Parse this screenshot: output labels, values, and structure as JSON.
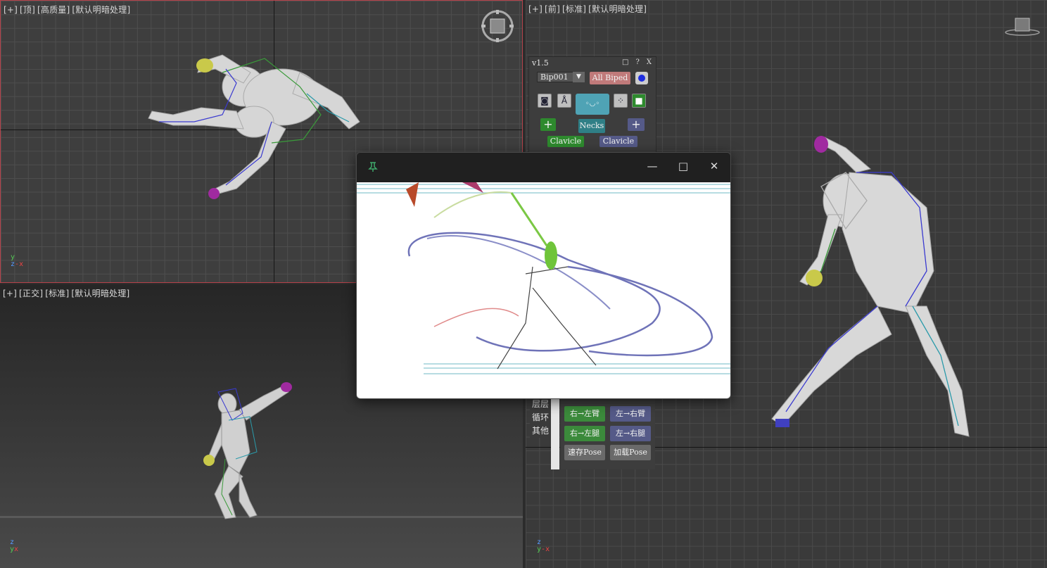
{
  "viewports": {
    "top": {
      "label": [
        "[+]",
        "[顶]",
        "[高质量]",
        "[默认明暗处理]"
      ],
      "axes": {
        "y": "y",
        "z": "z",
        "x": "x"
      }
    },
    "left": {
      "label": [
        "[+]",
        "[正交]",
        "[标准]",
        "[默认明暗处理]"
      ],
      "axes": {
        "y": "y",
        "z": "z",
        "x": "x"
      }
    },
    "front": {
      "label": [
        "[+]",
        "[前]",
        "[标准]",
        "[默认明暗处理]"
      ],
      "axes": {
        "y": "y",
        "z": "z",
        "x": "x"
      }
    }
  },
  "biped_panel": {
    "version": "v1.5",
    "title_buttons": [
      "□",
      "?",
      "X"
    ],
    "bip_select": "Bip001",
    "all_biped": "All Biped",
    "necks": "Necks",
    "clavicle_left": "Clavicle",
    "clavicle_right": "Clavicle",
    "plus": "+"
  },
  "lower_panel": {
    "side_tabs": [
      "层层",
      "循环",
      "其他"
    ],
    "buttons": [
      {
        "label": "右→左臂",
        "color": "#3b8a3b"
      },
      {
        "label": "左→右臂",
        "color": "#555a88"
      },
      {
        "label": "右→左腿",
        "color": "#3b8a3b"
      },
      {
        "label": "左→右腿",
        "color": "#555a88"
      },
      {
        "label": "速存Pose",
        "color": "#6a6a6a"
      },
      {
        "label": "加载Pose",
        "color": "#6a6a6a"
      }
    ]
  },
  "floating_window": {
    "pin_icon": "pin-icon",
    "controls": [
      "—",
      "□",
      "✕"
    ]
  },
  "colors": {
    "green_btn": "#3b8a3b",
    "blue_btn": "#555a88",
    "teal_btn": "#2f7f86",
    "pink_btn": "#c07a7a",
    "active_border": "#b5424a"
  }
}
